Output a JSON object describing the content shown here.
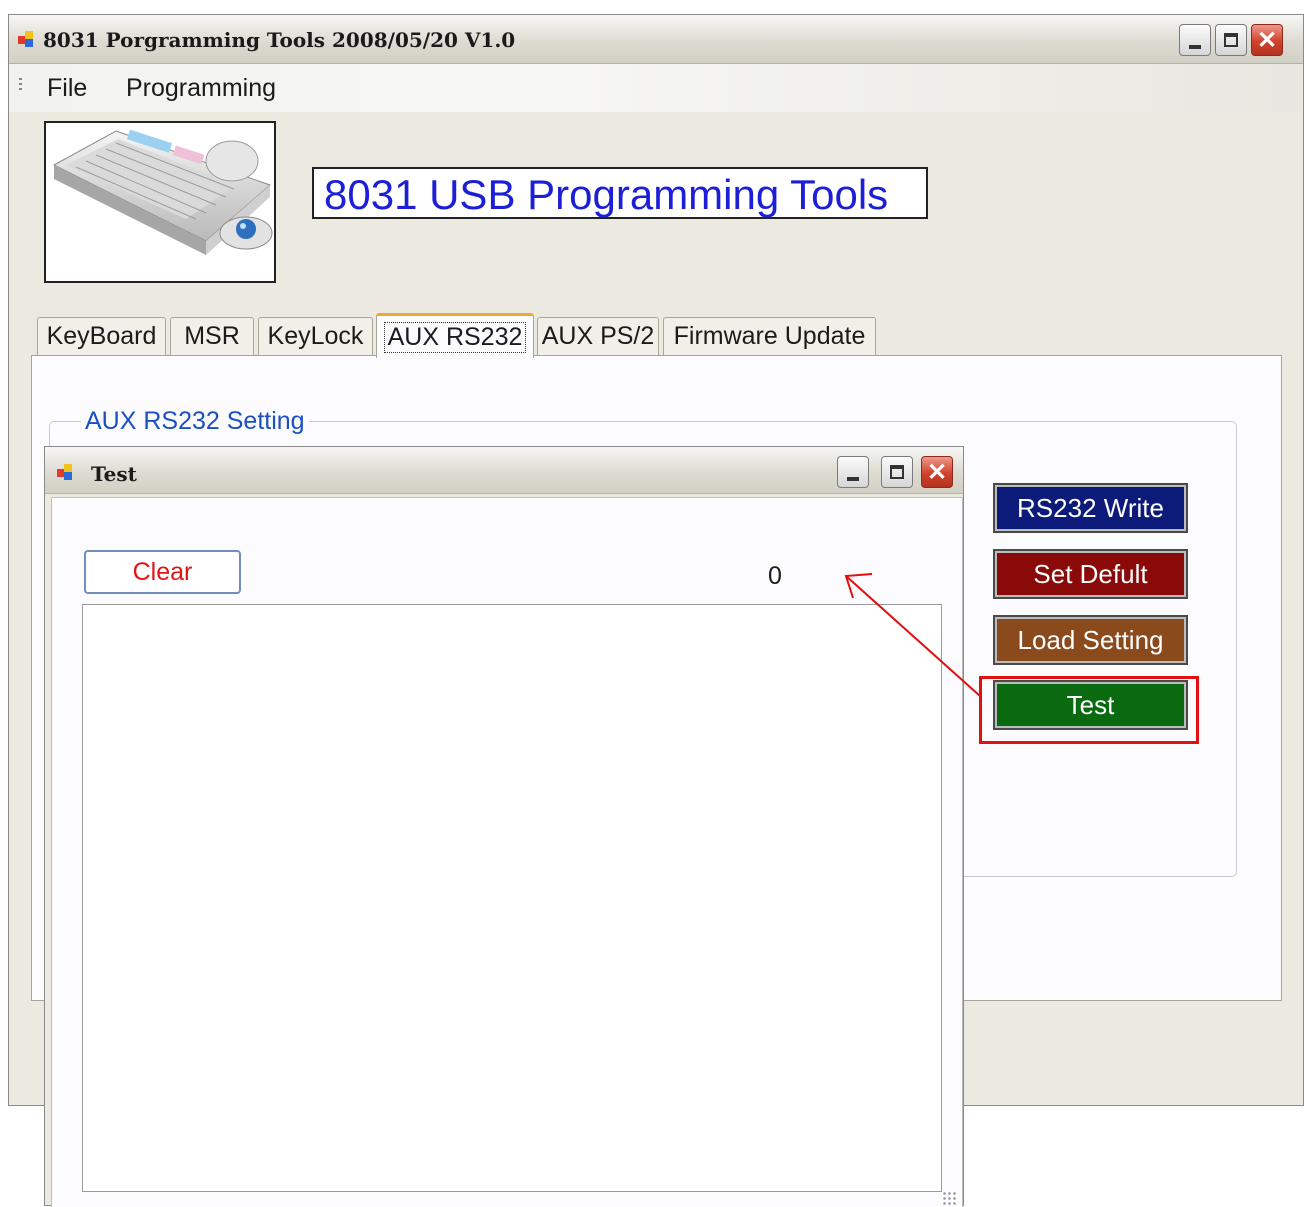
{
  "app": {
    "title": "8031 Porgramming Tools 2008/05/20 V1.0"
  },
  "menu": {
    "items": [
      "File",
      "Programming"
    ]
  },
  "header": {
    "title": "8031 USB Programming Tools"
  },
  "tabs": [
    {
      "label": "KeyBoard",
      "active": false
    },
    {
      "label": "MSR",
      "active": false
    },
    {
      "label": "KeyLock",
      "active": false
    },
    {
      "label": "AUX RS232",
      "active": true
    },
    {
      "label": "AUX PS/2",
      "active": false
    },
    {
      "label": "Firmware Update",
      "active": false
    }
  ],
  "aux_rs232": {
    "group_label": "AUX RS232 Setting",
    "buttons": [
      {
        "label": "RS232 Write",
        "color": "#0c1a7a"
      },
      {
        "label": "Set Defult",
        "color": "#8a0a0a"
      },
      {
        "label": "Load Setting",
        "color": "#8b4a1c"
      },
      {
        "label": "Test",
        "color": "#0a6a10"
      }
    ]
  },
  "test_window": {
    "title": "Test",
    "clear_label": "Clear",
    "count": "0",
    "log_text": ""
  },
  "annotation": {
    "color": "#e01010"
  }
}
